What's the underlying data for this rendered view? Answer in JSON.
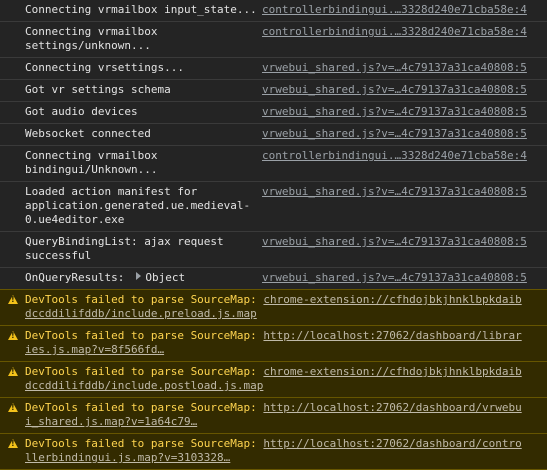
{
  "logs": [
    {
      "message": "Connecting vrmailbox input_state...",
      "source": "controllerbindingui.…3328d240e71cba58e:4"
    },
    {
      "message": "Connecting vrmailbox\nsettings/unknown...",
      "source": "controllerbindingui.…3328d240e71cba58e:4"
    },
    {
      "message": "Connecting vrsettings...",
      "source": "vrwebui_shared.js?v=…4c79137a31ca40808:5"
    },
    {
      "message": "Got vr settings schema",
      "source": "vrwebui_shared.js?v=…4c79137a31ca40808:5"
    },
    {
      "message": "Got audio devices",
      "source": "vrwebui_shared.js?v=…4c79137a31ca40808:5"
    },
    {
      "message": "Websocket connected",
      "source": "vrwebui_shared.js?v=…4c79137a31ca40808:5"
    },
    {
      "message": "Connecting vrmailbox\nbindingui/Unknown...",
      "source": "controllerbindingui.…3328d240e71cba58e:4"
    },
    {
      "message": "Loaded action manifest for\napplication.generated.ue.medieval-0.ue4editor.exe",
      "source": "vrwebui_shared.js?v=…4c79137a31ca40808:5"
    },
    {
      "message": "QueryBindingList: ajax request\nsuccessful",
      "source": "vrwebui_shared.js?v=…4c79137a31ca40808:5"
    },
    {
      "message": "OnQueryResults:",
      "object_label": "Object",
      "source": "vrwebui_shared.js?v=…4c79137a31ca40808:5"
    }
  ],
  "warnings": [
    {
      "label": "DevTools failed to parse SourceMap:",
      "url": "chrome-extension://cfhdojbkjhnklbpkdaibdccddilifddb/include.preload.js.map"
    },
    {
      "label": "DevTools failed to parse SourceMap:",
      "url": "http://localhost:27062/dashboard/libraries.js.map?v=8f566fd…"
    },
    {
      "label": "DevTools failed to parse SourceMap:",
      "url": "chrome-extension://cfhdojbkjhnklbpkdaibdccddilifddb/include.postload.js.map"
    },
    {
      "label": "DevTools failed to parse SourceMap:",
      "url": "http://localhost:27062/dashboard/vrwebui_shared.js.map?v=1a64c79…"
    },
    {
      "label": "DevTools failed to parse SourceMap:",
      "url": "http://localhost:27062/dashboard/controllerbindingui.js.map?v=3103328…"
    }
  ],
  "colors": {
    "background": "#242424",
    "warning_background": "#332b00",
    "warning_text": "#ffd54f",
    "warning_icon": "#f3c21b"
  },
  "icons": {
    "warning": "warning-triangle-icon",
    "expand": "expand-caret-icon"
  }
}
